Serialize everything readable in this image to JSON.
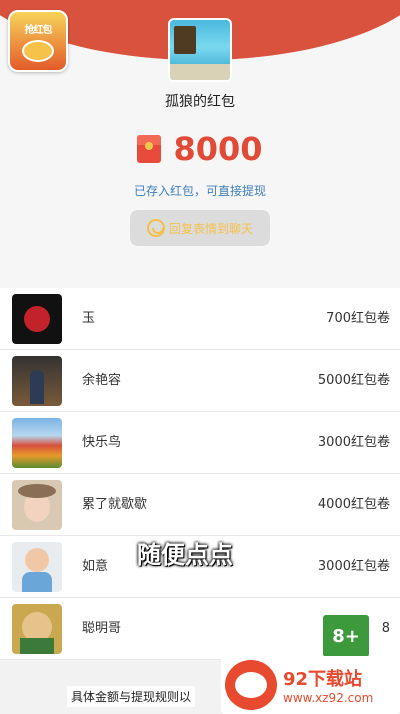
{
  "header": {
    "badge_text": "抢红包",
    "sender_name": "孤狼的红包",
    "amount": "8000",
    "saved_text": "已存入红包，可直接提现",
    "reply_label": "回复表情到聊天"
  },
  "list": [
    {
      "name": "玉",
      "value": "700红包卷"
    },
    {
      "name": "余艳容",
      "value": "5000红包卷"
    },
    {
      "name": "快乐鸟",
      "value": "3000红包卷"
    },
    {
      "name": "累了就歇歇",
      "value": "4000红包卷"
    },
    {
      "name": "如意",
      "value": "3000红包卷"
    },
    {
      "name": "聪明哥",
      "value": "8"
    }
  ],
  "overlay": {
    "caption": "随便点点",
    "age_rating": "8+",
    "bottom_note": "具体金额与提现规则以"
  },
  "watermark": {
    "brand": "92下载站",
    "url": "www.xz92.com"
  },
  "colors": {
    "accent": "#d9523e",
    "amount": "#e14a36",
    "link": "#3f7fbd"
  }
}
